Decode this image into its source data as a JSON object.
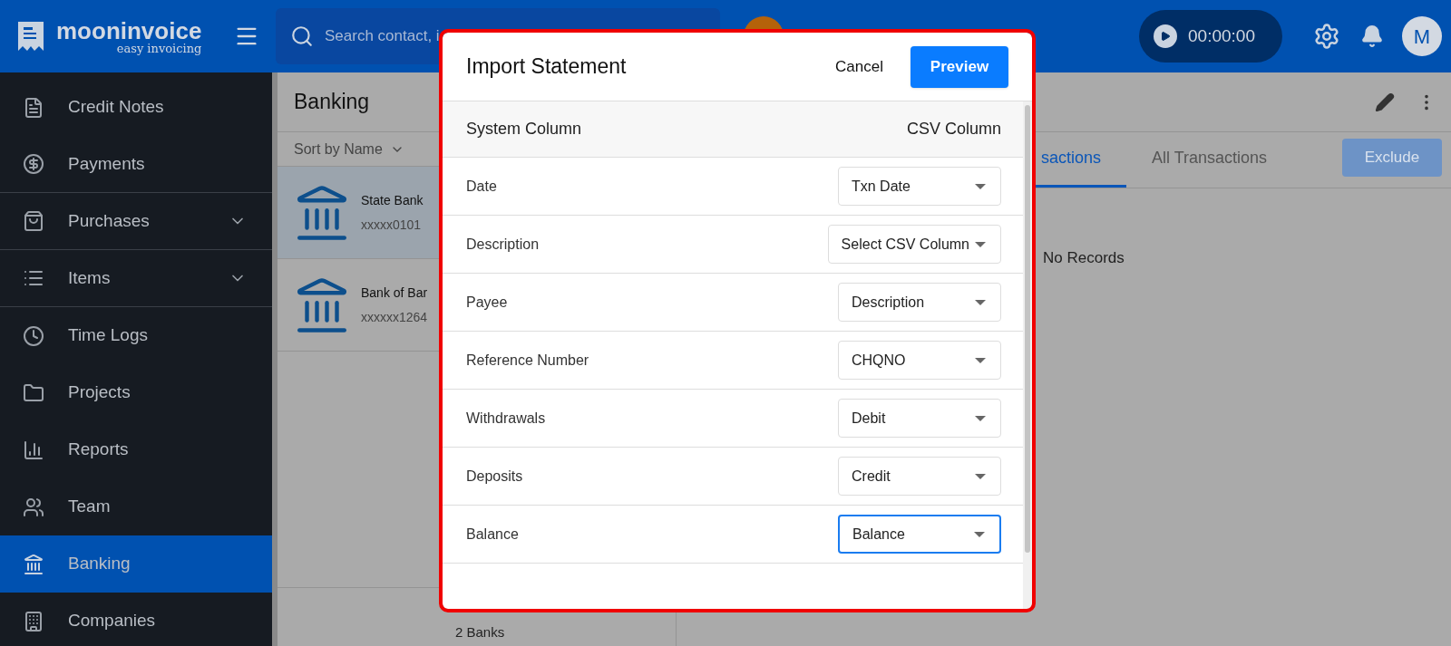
{
  "header": {
    "logo": {
      "name": "mooninvoice",
      "tagline": "easy invoicing"
    },
    "search": {
      "placeholder": "Search contact, i"
    },
    "timer": "00:00:00",
    "avatar": "M"
  },
  "sidebar": {
    "items": [
      {
        "label": "Credit Notes",
        "expandable": false,
        "selected": false
      },
      {
        "label": "Payments",
        "expandable": false,
        "selected": false
      },
      {
        "label": "Purchases",
        "expandable": true,
        "selected": false
      },
      {
        "label": "Items",
        "expandable": true,
        "selected": false
      },
      {
        "label": "Time Logs",
        "expandable": false,
        "selected": false
      },
      {
        "label": "Projects",
        "expandable": false,
        "selected": false
      },
      {
        "label": "Reports",
        "expandable": false,
        "selected": false
      },
      {
        "label": "Team",
        "expandable": false,
        "selected": false
      },
      {
        "label": "Banking",
        "expandable": false,
        "selected": true
      },
      {
        "label": "Companies",
        "expandable": false,
        "selected": false
      }
    ]
  },
  "banking": {
    "title": "Banking",
    "sort": "Sort by Name",
    "banks": [
      {
        "name": "State Bank",
        "number": "xxxxx0101",
        "selected": true
      },
      {
        "name": "Bank of Bar",
        "number": "xxxxxx1264",
        "selected": false
      }
    ],
    "footer": "2 Banks"
  },
  "details": {
    "tabs": [
      {
        "label": "sactions",
        "selected": true
      },
      {
        "label": "All Transactions",
        "selected": false
      }
    ],
    "exclude": "Exclude",
    "empty": "No Records"
  },
  "modal": {
    "title": "Import Statement",
    "cancel": "Cancel",
    "preview": "Preview",
    "columns": [
      "System Column",
      "CSV Column"
    ],
    "rows": [
      {
        "label": "Date",
        "value": "Txn Date",
        "focused": false
      },
      {
        "label": "Description",
        "value": "Select CSV Column",
        "focused": false
      },
      {
        "label": "Payee",
        "value": "Description",
        "focused": false
      },
      {
        "label": "Reference Number",
        "value": "CHQNO",
        "focused": false
      },
      {
        "label": "Withdrawals",
        "value": "Debit",
        "focused": false
      },
      {
        "label": "Deposits",
        "value": "Credit",
        "focused": false
      },
      {
        "label": "Balance",
        "value": "Balance",
        "focused": true
      }
    ]
  }
}
